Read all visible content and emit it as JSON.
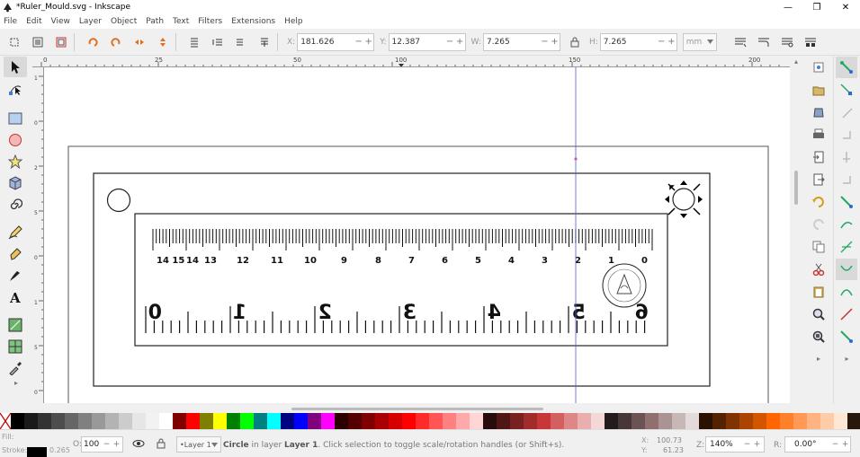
{
  "window": {
    "title": "*Ruler_Mould.svg - Inkscape",
    "minimize": "—",
    "maximize": "❐",
    "close": "✕"
  },
  "menu": [
    "File",
    "Edit",
    "View",
    "Layer",
    "Object",
    "Path",
    "Text",
    "Filters",
    "Extensions",
    "Help"
  ],
  "toolbar": {
    "x_label": "X:",
    "x_value": "181.626",
    "y_label": "Y:",
    "y_value": "12.387",
    "w_label": "W:",
    "w_value": "7.265",
    "h_label": "H:",
    "h_value": "7.265",
    "unit": "mm",
    "minus": "−",
    "plus": "+"
  },
  "ruler": {
    "top_labels": [
      "0",
      "25",
      "50",
      "100",
      "150",
      "200"
    ],
    "left_labels": [
      "1",
      "0",
      "2",
      "5",
      "0",
      "1",
      "5",
      "0",
      "1",
      "0",
      "1"
    ]
  },
  "ruler_ticks_top": [
    "14 15",
    "14",
    "13",
    "12",
    "11",
    "10",
    "9",
    "8",
    "7",
    "6",
    "5",
    "4",
    "3",
    "2",
    "1",
    "0"
  ],
  "ruler_ticks_bottom": [
    "0",
    "1",
    "2",
    "3",
    "4",
    "5",
    "6"
  ],
  "palette": [
    "#000000",
    "#1a1a1a",
    "#333333",
    "#4d4d4d",
    "#666666",
    "#808080",
    "#999999",
    "#b3b3b3",
    "#cccccc",
    "#e6e6e6",
    "#f2f2f2",
    "#ffffff",
    "#800000",
    "#ff0000",
    "#808000",
    "#ffff00",
    "#008000",
    "#00ff00",
    "#008080",
    "#00ffff",
    "#000080",
    "#0000ff",
    "#800080",
    "#ff00ff",
    "#2b0000",
    "#550000",
    "#800000",
    "#aa0000",
    "#d40000",
    "#ff0000",
    "#ff2a2a",
    "#ff5555",
    "#ff8080",
    "#ffaaaa",
    "#ffd5d5",
    "#280b0b",
    "#501616",
    "#782121",
    "#a02c2c",
    "#c83737",
    "#d35f5f",
    "#de8787",
    "#e9afaf",
    "#f4d7d7",
    "#241c1c",
    "#483737",
    "#6c5353",
    "#916f6f",
    "#ac9393",
    "#c8b7b7",
    "#e3dbdb",
    "#2b1100",
    "#552200",
    "#803300",
    "#aa4400",
    "#d45500",
    "#ff6600",
    "#ff7f2a",
    "#ff9955",
    "#ffb380",
    "#ffccaa",
    "#ffe6d5",
    "#28170b",
    "#502d16",
    "#784421",
    "#a05a2c",
    "#c87137"
  ],
  "status": {
    "fill_label": "Fill:",
    "stroke_label": "Stroke:",
    "stroke_width": "0.265",
    "opacity_label": "O:",
    "opacity_value": "100",
    "layer": "•Layer 1",
    "message_strong": "Circle",
    "message": " in layer ",
    "message_layer": "Layer 1",
    "message_rest": ". Click selection to toggle scale/rotation handles (or Shift+s).",
    "x_label": "X:",
    "x_value": "100.73",
    "y_label": "Y:",
    "y_value": "61.23",
    "zoom_label": "Z:",
    "zoom_value": "140%",
    "rot_label": "R:",
    "rot_value": "0.00°"
  }
}
